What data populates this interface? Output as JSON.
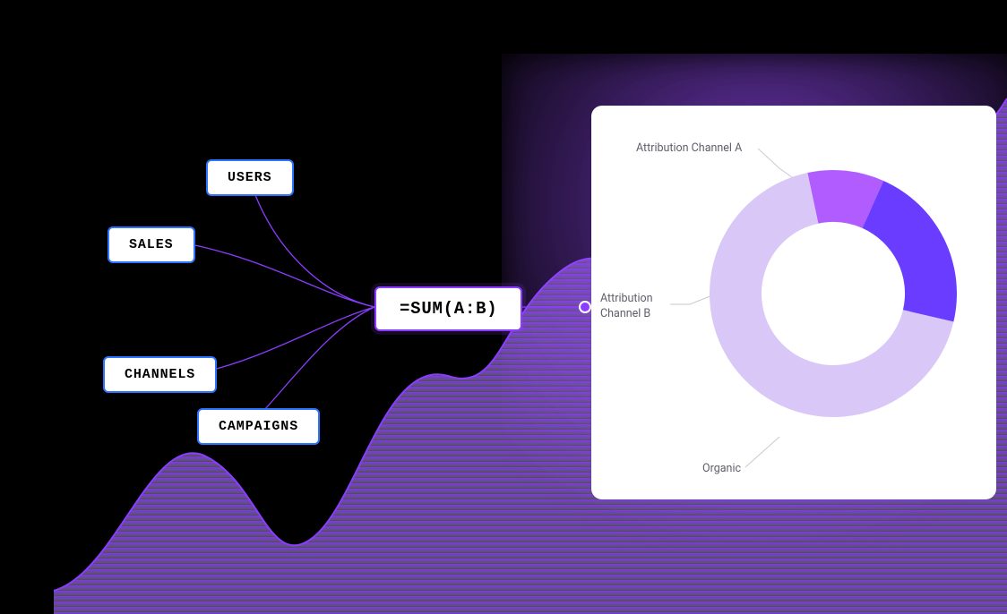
{
  "tags": {
    "users": "USERS",
    "sales": "SALES",
    "channels": "CHANNELS",
    "campaigns": "CAMPAIGNS"
  },
  "formula": "=SUM(A:B)",
  "donut": {
    "labels": {
      "channel_a": "Attribution Channel A",
      "channel_b": "Attribution\nChannel B",
      "organic": "Organic"
    }
  },
  "chart_data": {
    "type": "pie",
    "title": "",
    "series": [
      {
        "name": "Attribution Channel A",
        "value": 10,
        "color": "#b05cff"
      },
      {
        "name": "Attribution Channel B",
        "value": 22,
        "color": "#6a3cff"
      },
      {
        "name": "Organic",
        "value": 68,
        "color": "#d9c8f7"
      }
    ],
    "donut_inner_ratio": 0.58
  },
  "colors": {
    "black": "#000000",
    "white": "#ffffff",
    "tag_border": "#2b74ff",
    "formula_border": "#8b3dff",
    "connector": "#8b3dff",
    "area_top": "#8b3dff",
    "area_bottom": "#c9a6ff"
  }
}
